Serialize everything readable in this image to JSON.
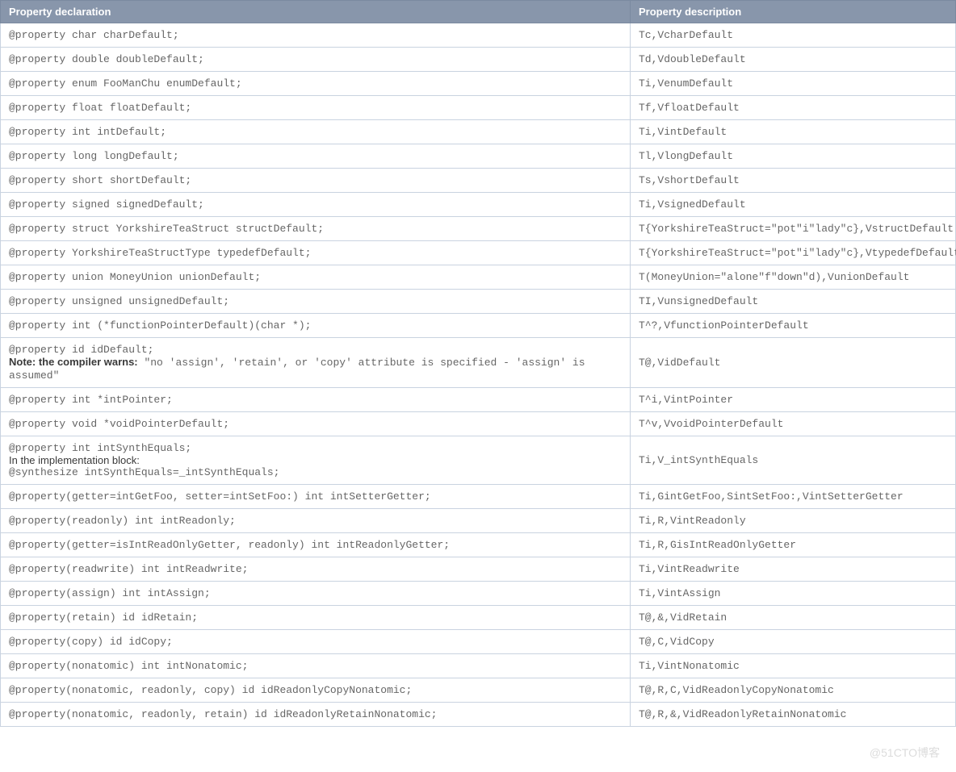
{
  "table": {
    "headers": {
      "col1": "Property declaration",
      "col2": "Property description"
    },
    "rows": [
      {
        "declaration": "@property char charDefault;",
        "description": "Tc,VcharDefault"
      },
      {
        "declaration": "@property double doubleDefault;",
        "description": "Td,VdoubleDefault"
      },
      {
        "declaration": "@property enum FooManChu enumDefault;",
        "description": "Ti,VenumDefault"
      },
      {
        "declaration": "@property float floatDefault;",
        "description": "Tf,VfloatDefault"
      },
      {
        "declaration": "@property int intDefault;",
        "description": "Ti,VintDefault"
      },
      {
        "declaration": "@property long longDefault;",
        "description": "Tl,VlongDefault"
      },
      {
        "declaration": "@property short shortDefault;",
        "description": "Ts,VshortDefault"
      },
      {
        "declaration": "@property signed signedDefault;",
        "description": "Ti,VsignedDefault"
      },
      {
        "declaration": "@property struct YorkshireTeaStruct structDefault;",
        "description": "T{YorkshireTeaStruct=\"pot\"i\"lady\"c},VstructDefault"
      },
      {
        "declaration": "@property YorkshireTeaStructType typedefDefault;",
        "description": "T{YorkshireTeaStruct=\"pot\"i\"lady\"c},VtypedefDefault"
      },
      {
        "declaration": "@property union MoneyUnion unionDefault;",
        "description": "T(MoneyUnion=\"alone\"f\"down\"d),VunionDefault"
      },
      {
        "declaration": "@property unsigned unsignedDefault;",
        "description": "TI,VunsignedDefault"
      },
      {
        "declaration": "@property int (*functionPointerDefault)(char *);",
        "description": "T^?,VfunctionPointerDefault"
      },
      {
        "declaration_parts": {
          "code1": "@property id idDefault;",
          "note_bold": "Note: the compiler warns:",
          "note_code": " \"no 'assign', 'retain', or 'copy' attribute is specified - 'assign' is assumed\""
        },
        "description": "T@,VidDefault",
        "kind": "note"
      },
      {
        "declaration": "@property int *intPointer;",
        "description": "T^i,VintPointer"
      },
      {
        "declaration": "@property void *voidPointerDefault;",
        "description": "T^v,VvoidPointerDefault"
      },
      {
        "declaration_parts": {
          "code1": "@property int intSynthEquals;",
          "note_text": "In the implementation block:",
          "code2": "@synthesize intSynthEquals=_intSynthEquals;"
        },
        "description": "Ti,V_intSynthEquals",
        "kind": "impl"
      },
      {
        "declaration": "@property(getter=intGetFoo, setter=intSetFoo:) int intSetterGetter;",
        "description": "Ti,GintGetFoo,SintSetFoo:,VintSetterGetter"
      },
      {
        "declaration": "@property(readonly) int intReadonly;",
        "description": "Ti,R,VintReadonly"
      },
      {
        "declaration": "@property(getter=isIntReadOnlyGetter, readonly) int intReadonlyGetter;",
        "description": "Ti,R,GisIntReadOnlyGetter"
      },
      {
        "declaration": "@property(readwrite) int intReadwrite;",
        "description": "Ti,VintReadwrite"
      },
      {
        "declaration": "@property(assign) int intAssign;",
        "description": "Ti,VintAssign"
      },
      {
        "declaration": "@property(retain) id idRetain;",
        "description": "T@,&,VidRetain"
      },
      {
        "declaration": "@property(copy) id idCopy;",
        "description": "T@,C,VidCopy"
      },
      {
        "declaration": "@property(nonatomic) int intNonatomic;",
        "description": "Ti,VintNonatomic"
      },
      {
        "declaration": "@property(nonatomic, readonly, copy) id idReadonlyCopyNonatomic;",
        "description": "T@,R,C,VidReadonlyCopyNonatomic"
      },
      {
        "declaration": "@property(nonatomic, readonly, retain) id idReadonlyRetainNonatomic;",
        "description": "T@,R,&,VidReadonlyRetainNonatomic"
      }
    ]
  },
  "watermark": "@51CTO博客"
}
